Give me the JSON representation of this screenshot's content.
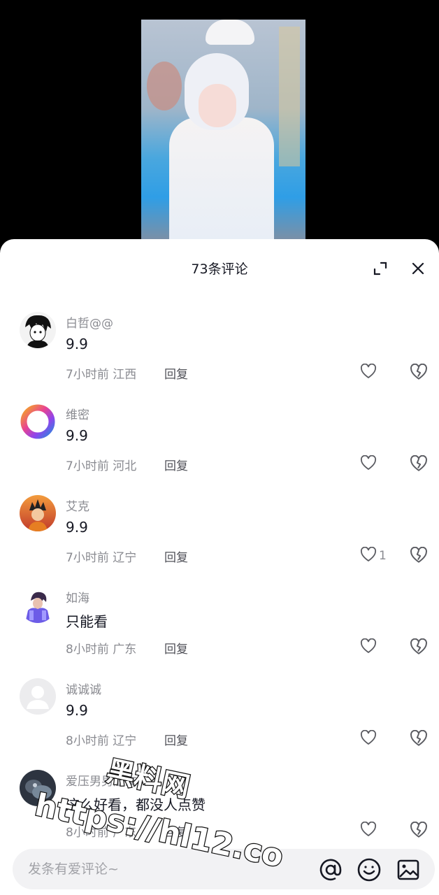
{
  "header": {
    "title": "73条评论"
  },
  "comments": [
    {
      "name": "白哲@@",
      "text": "9.9",
      "time": "7小时前",
      "region": "江西",
      "reply": "回复",
      "likes": ""
    },
    {
      "name": "维密",
      "text": "9.9",
      "time": "7小时前",
      "region": "河北",
      "reply": "回复",
      "likes": ""
    },
    {
      "name": "艾克",
      "text": "9.9",
      "time": "7小时前",
      "region": "辽宁",
      "reply": "回复",
      "likes": "1"
    },
    {
      "name": "如海",
      "text": "只能看",
      "time": "8小时前",
      "region": "广东",
      "reply": "回复",
      "likes": ""
    },
    {
      "name": "诚诚诚",
      "text": "9.9",
      "time": "8小时前",
      "region": "辽宁",
      "reply": "回复",
      "likes": ""
    },
    {
      "name": "爱压男男朋友",
      "text": "这么好看，都没人点赞",
      "time": "8小时前",
      "region": "广东",
      "reply": "回复",
      "likes": ""
    }
  ],
  "input": {
    "placeholder": "发条有爱评论~"
  },
  "watermark": {
    "line1": "黑料网",
    "line2": "https://hl12.co"
  },
  "icons": {
    "expand": "expand-icon",
    "close": "close-icon",
    "like": "heart-outline-icon",
    "dislike": "broken-heart-icon",
    "at": "at-sign-icon",
    "emoji": "smiley-face-icon",
    "image": "image-picture-icon"
  }
}
